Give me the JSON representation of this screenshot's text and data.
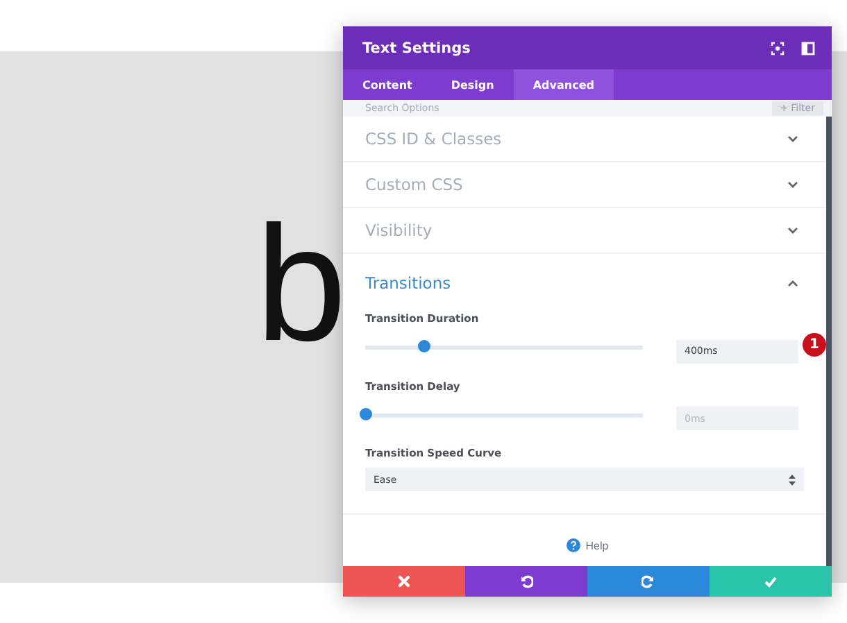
{
  "canvas": {
    "letter": "b"
  },
  "panel": {
    "title": "Text Settings",
    "tabs": [
      {
        "label": "Content",
        "selected": false
      },
      {
        "label": "Design",
        "selected": false
      },
      {
        "label": "Advanced",
        "selected": true
      }
    ],
    "search": {
      "placeholder": "Search Options",
      "filter": "+ Filter"
    },
    "sections": [
      {
        "title": "CSS ID & Classes",
        "expanded": false
      },
      {
        "title": "Custom CSS",
        "expanded": false
      },
      {
        "title": "Visibility",
        "expanded": false
      },
      {
        "title": "Transitions",
        "expanded": true,
        "fields": [
          {
            "kind": "slider",
            "label": "Transition Duration",
            "level": 0.21,
            "value": "400ms",
            "badge": "1"
          },
          {
            "kind": "slider",
            "label": "Transition Delay",
            "level": 0,
            "placeholder": "0ms"
          },
          {
            "kind": "select",
            "label": "Transition Speed Curve",
            "value": "Ease"
          }
        ]
      }
    ],
    "help": "Help",
    "actions": [
      {
        "kind": "cancel"
      },
      {
        "kind": "undo"
      },
      {
        "kind": "redo"
      },
      {
        "kind": "save"
      }
    ]
  }
}
